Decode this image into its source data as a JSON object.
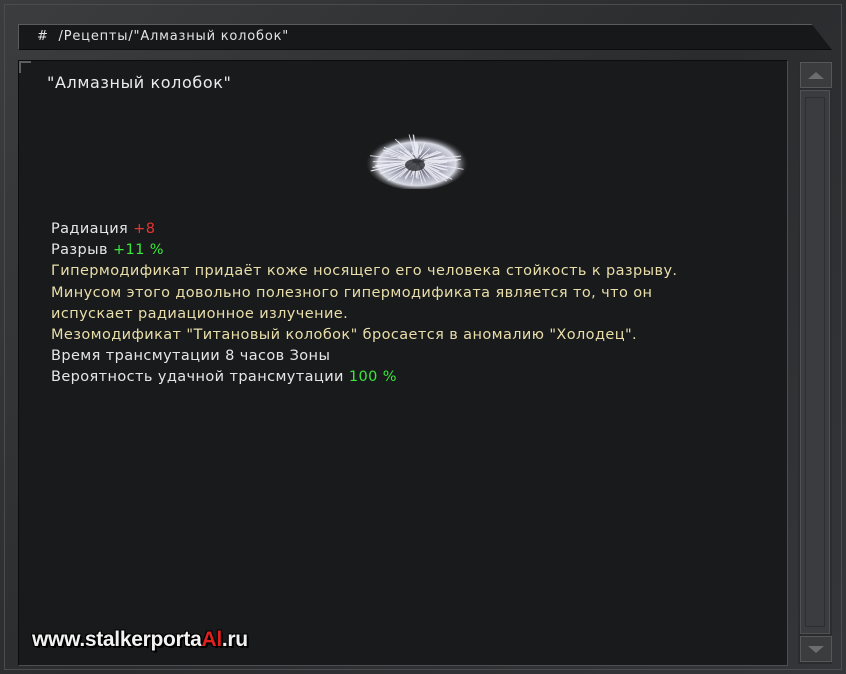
{
  "header": {
    "path": "#  /Рецепты/\"Алмазный колобок\""
  },
  "content": {
    "title": "\"Алмазный колобок\"",
    "artifact_icon": "diamond-kolobok-artifact-icon",
    "stats": {
      "radiation_label": "Радиация ",
      "radiation_value": "+8",
      "rupture_label": "Разрыв ",
      "rupture_value": "+11 %"
    },
    "description_lines": [
      "Гипермодификат придаёт коже носящего его человека стойкость к разрыву.",
      "Минусом этого довольно полезного гипермодификата является то, что он",
      "испускает радиационное излучение.",
      "Мезомодификат \"Титановый колобок\" бросается в аномалию \"Холодец\"."
    ],
    "transmutation_time": "Время трансмутации 8 часов Зоны",
    "probability_label": "Вероятность удачной трансмутации ",
    "probability_value": "100 %"
  },
  "watermark": {
    "prefix": "www.stalkerporta",
    "accent": "Al",
    "suffix": ".ru"
  },
  "colors": {
    "background": "#181a1b",
    "frame": "#2e3032",
    "text_white": "#e6e6e6",
    "text_yellow": "#e9deaa",
    "negative_red": "#e43434",
    "positive_green": "#3ae83a"
  }
}
